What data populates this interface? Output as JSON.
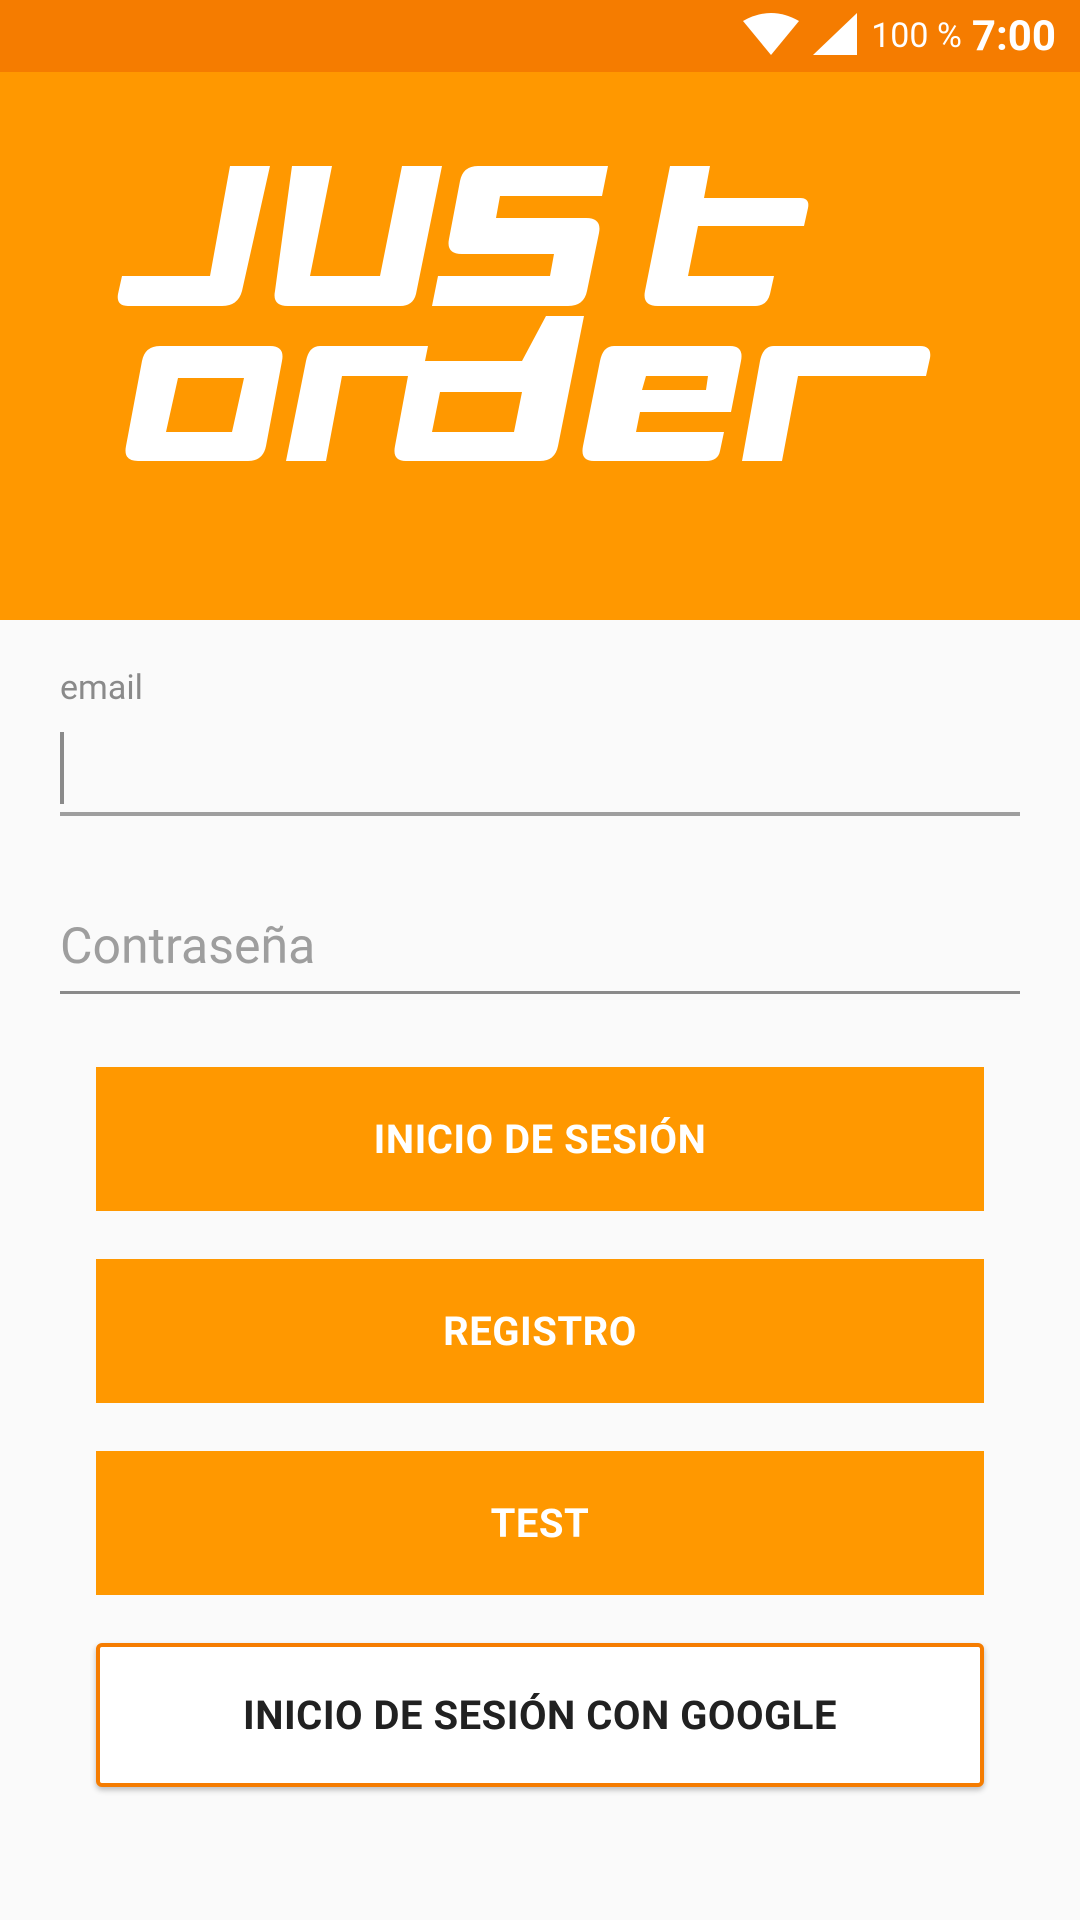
{
  "status_bar": {
    "battery": "100 %",
    "time": "7:00",
    "icons": [
      "wifi-icon",
      "cell-signal-icon"
    ]
  },
  "logo": {
    "text": "JUST ORDER"
  },
  "form": {
    "email_label": "email",
    "email_value": "",
    "password_placeholder": "Contraseña"
  },
  "buttons": {
    "login": "INICIO DE SESIÓN",
    "register": "REGISTRO",
    "test": "TEST",
    "google": "INICIO DE SESIÓN CON GOOGLE"
  },
  "colors": {
    "status_bar": "#f57c00",
    "primary": "#ff9800",
    "background": "#fafafa"
  }
}
